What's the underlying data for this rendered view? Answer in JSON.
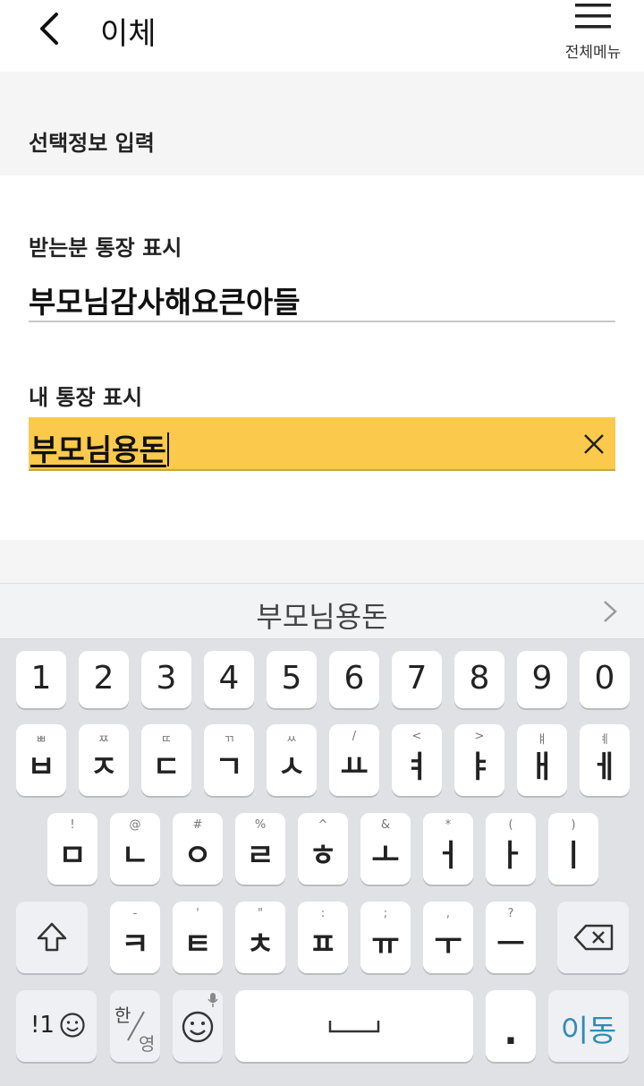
{
  "header": {
    "title": "이체",
    "menu_label": "전체메뉴",
    "back_icon": "chevron-left-icon",
    "menu_icon": "hamburger-icon"
  },
  "section": {
    "title": "선택정보 입력"
  },
  "form": {
    "recipient_label": "받는분 통장 표시",
    "recipient_value": "부모님감사해요큰아들",
    "my_label": "내 통장 표시",
    "my_value": "부모님용돈"
  },
  "keyboard": {
    "suggestion": "부모님용돈",
    "numbers": [
      "1",
      "2",
      "3",
      "4",
      "5",
      "6",
      "7",
      "8",
      "9",
      "0"
    ],
    "row1": [
      {
        "main": "ㅂ",
        "sub": "ㅃ"
      },
      {
        "main": "ㅈ",
        "sub": "ㅉ"
      },
      {
        "main": "ㄷ",
        "sub": "ㄸ"
      },
      {
        "main": "ㄱ",
        "sub": "ㄲ"
      },
      {
        "main": "ㅅ",
        "sub": "ㅆ"
      },
      {
        "main": "ㅛ",
        "sub": "/"
      },
      {
        "main": "ㅕ",
        "sub": "<"
      },
      {
        "main": "ㅑ",
        "sub": ">"
      },
      {
        "main": "ㅐ",
        "sub": "ㅒ"
      },
      {
        "main": "ㅔ",
        "sub": "ㅖ"
      }
    ],
    "row2": [
      {
        "main": "ㅁ",
        "sub": "!"
      },
      {
        "main": "ㄴ",
        "sub": "@"
      },
      {
        "main": "ㅇ",
        "sub": "#"
      },
      {
        "main": "ㄹ",
        "sub": "%"
      },
      {
        "main": "ㅎ",
        "sub": "^"
      },
      {
        "main": "ㅗ",
        "sub": "&"
      },
      {
        "main": "ㅓ",
        "sub": "*"
      },
      {
        "main": "ㅏ",
        "sub": "("
      },
      {
        "main": "ㅣ",
        "sub": ")"
      }
    ],
    "row3": [
      {
        "main": "ㅋ",
        "sub": "-"
      },
      {
        "main": "ㅌ",
        "sub": "'"
      },
      {
        "main": "ㅊ",
        "sub": "\""
      },
      {
        "main": "ㅍ",
        "sub": ":"
      },
      {
        "main": "ㅠ",
        "sub": ";"
      },
      {
        "main": "ㅜ",
        "sub": ","
      },
      {
        "main": "ㅡ",
        "sub": "?"
      }
    ],
    "symbols_label": "!1",
    "lang_top": "한",
    "lang_bottom": "영",
    "period": ".",
    "enter_label": "이동"
  },
  "colors": {
    "highlight": "#fbc94c",
    "enter_text": "#2f8bb6",
    "keyboard_bg": "#dfe1e5"
  }
}
